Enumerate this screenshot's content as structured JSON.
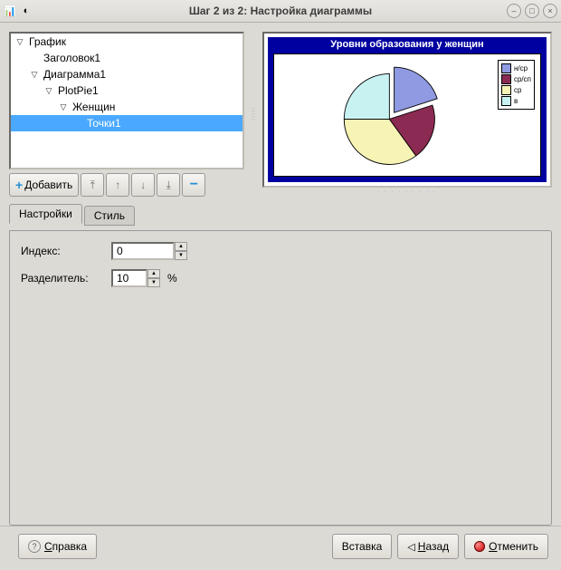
{
  "window": {
    "title": "Шаг 2 из 2: Настройка диаграммы"
  },
  "tree": {
    "items": [
      {
        "label": "График",
        "depth": 0,
        "expanded": true,
        "leaf": false,
        "selected": false
      },
      {
        "label": "Заголовок1",
        "depth": 1,
        "expanded": false,
        "leaf": true,
        "selected": false
      },
      {
        "label": "Диаграмма1",
        "depth": 1,
        "expanded": true,
        "leaf": false,
        "selected": false
      },
      {
        "label": "PlotPie1",
        "depth": 2,
        "expanded": true,
        "leaf": false,
        "selected": false
      },
      {
        "label": "Женщин",
        "depth": 3,
        "expanded": true,
        "leaf": false,
        "selected": false
      },
      {
        "label": "Точки1",
        "depth": 4,
        "expanded": false,
        "leaf": true,
        "selected": true
      }
    ]
  },
  "toolbar": {
    "add_label": "Добавить"
  },
  "tabs": {
    "settings_label": "Настройки",
    "style_label": "Стиль"
  },
  "form": {
    "index_label": "Индекс:",
    "index_value": "0",
    "splitter_label": "Разделитель:",
    "splitter_value": "10",
    "splitter_suffix": "%"
  },
  "footer": {
    "help_label": "Справка",
    "insert_label": "Вставка",
    "back_label": "Назад",
    "cancel_label": "Отменить"
  },
  "chart_data": {
    "type": "pie",
    "title": "Уровни образования у женщин",
    "series": [
      {
        "name": "н/ср",
        "value": 20,
        "color": "#8f9ae2",
        "exploded": true
      },
      {
        "name": "ср/сп",
        "value": 20,
        "color": "#8b2a52"
      },
      {
        "name": "ср",
        "value": 35,
        "color": "#f6f3b5"
      },
      {
        "name": "в",
        "value": 25,
        "color": "#c8f2f2"
      }
    ]
  }
}
